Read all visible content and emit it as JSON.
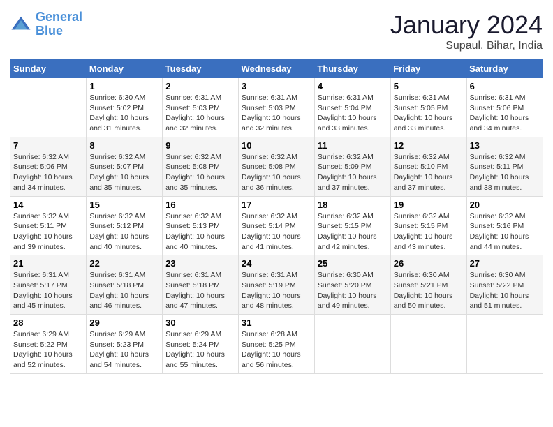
{
  "logo": {
    "line1": "General",
    "line2": "Blue"
  },
  "title": "January 2024",
  "subtitle": "Supaul, Bihar, India",
  "weekdays": [
    "Sunday",
    "Monday",
    "Tuesday",
    "Wednesday",
    "Thursday",
    "Friday",
    "Saturday"
  ],
  "weeks": [
    [
      {
        "day": "",
        "info": ""
      },
      {
        "day": "1",
        "info": "Sunrise: 6:30 AM\nSunset: 5:02 PM\nDaylight: 10 hours\nand 31 minutes."
      },
      {
        "day": "2",
        "info": "Sunrise: 6:31 AM\nSunset: 5:03 PM\nDaylight: 10 hours\nand 32 minutes."
      },
      {
        "day": "3",
        "info": "Sunrise: 6:31 AM\nSunset: 5:03 PM\nDaylight: 10 hours\nand 32 minutes."
      },
      {
        "day": "4",
        "info": "Sunrise: 6:31 AM\nSunset: 5:04 PM\nDaylight: 10 hours\nand 33 minutes."
      },
      {
        "day": "5",
        "info": "Sunrise: 6:31 AM\nSunset: 5:05 PM\nDaylight: 10 hours\nand 33 minutes."
      },
      {
        "day": "6",
        "info": "Sunrise: 6:31 AM\nSunset: 5:06 PM\nDaylight: 10 hours\nand 34 minutes."
      }
    ],
    [
      {
        "day": "7",
        "info": "Sunrise: 6:32 AM\nSunset: 5:06 PM\nDaylight: 10 hours\nand 34 minutes."
      },
      {
        "day": "8",
        "info": "Sunrise: 6:32 AM\nSunset: 5:07 PM\nDaylight: 10 hours\nand 35 minutes."
      },
      {
        "day": "9",
        "info": "Sunrise: 6:32 AM\nSunset: 5:08 PM\nDaylight: 10 hours\nand 35 minutes."
      },
      {
        "day": "10",
        "info": "Sunrise: 6:32 AM\nSunset: 5:08 PM\nDaylight: 10 hours\nand 36 minutes."
      },
      {
        "day": "11",
        "info": "Sunrise: 6:32 AM\nSunset: 5:09 PM\nDaylight: 10 hours\nand 37 minutes."
      },
      {
        "day": "12",
        "info": "Sunrise: 6:32 AM\nSunset: 5:10 PM\nDaylight: 10 hours\nand 37 minutes."
      },
      {
        "day": "13",
        "info": "Sunrise: 6:32 AM\nSunset: 5:11 PM\nDaylight: 10 hours\nand 38 minutes."
      }
    ],
    [
      {
        "day": "14",
        "info": "Sunrise: 6:32 AM\nSunset: 5:11 PM\nDaylight: 10 hours\nand 39 minutes."
      },
      {
        "day": "15",
        "info": "Sunrise: 6:32 AM\nSunset: 5:12 PM\nDaylight: 10 hours\nand 40 minutes."
      },
      {
        "day": "16",
        "info": "Sunrise: 6:32 AM\nSunset: 5:13 PM\nDaylight: 10 hours\nand 40 minutes."
      },
      {
        "day": "17",
        "info": "Sunrise: 6:32 AM\nSunset: 5:14 PM\nDaylight: 10 hours\nand 41 minutes."
      },
      {
        "day": "18",
        "info": "Sunrise: 6:32 AM\nSunset: 5:15 PM\nDaylight: 10 hours\nand 42 minutes."
      },
      {
        "day": "19",
        "info": "Sunrise: 6:32 AM\nSunset: 5:15 PM\nDaylight: 10 hours\nand 43 minutes."
      },
      {
        "day": "20",
        "info": "Sunrise: 6:32 AM\nSunset: 5:16 PM\nDaylight: 10 hours\nand 44 minutes."
      }
    ],
    [
      {
        "day": "21",
        "info": "Sunrise: 6:31 AM\nSunset: 5:17 PM\nDaylight: 10 hours\nand 45 minutes."
      },
      {
        "day": "22",
        "info": "Sunrise: 6:31 AM\nSunset: 5:18 PM\nDaylight: 10 hours\nand 46 minutes."
      },
      {
        "day": "23",
        "info": "Sunrise: 6:31 AM\nSunset: 5:18 PM\nDaylight: 10 hours\nand 47 minutes."
      },
      {
        "day": "24",
        "info": "Sunrise: 6:31 AM\nSunset: 5:19 PM\nDaylight: 10 hours\nand 48 minutes."
      },
      {
        "day": "25",
        "info": "Sunrise: 6:30 AM\nSunset: 5:20 PM\nDaylight: 10 hours\nand 49 minutes."
      },
      {
        "day": "26",
        "info": "Sunrise: 6:30 AM\nSunset: 5:21 PM\nDaylight: 10 hours\nand 50 minutes."
      },
      {
        "day": "27",
        "info": "Sunrise: 6:30 AM\nSunset: 5:22 PM\nDaylight: 10 hours\nand 51 minutes."
      }
    ],
    [
      {
        "day": "28",
        "info": "Sunrise: 6:29 AM\nSunset: 5:22 PM\nDaylight: 10 hours\nand 52 minutes."
      },
      {
        "day": "29",
        "info": "Sunrise: 6:29 AM\nSunset: 5:23 PM\nDaylight: 10 hours\nand 54 minutes."
      },
      {
        "day": "30",
        "info": "Sunrise: 6:29 AM\nSunset: 5:24 PM\nDaylight: 10 hours\nand 55 minutes."
      },
      {
        "day": "31",
        "info": "Sunrise: 6:28 AM\nSunset: 5:25 PM\nDaylight: 10 hours\nand 56 minutes."
      },
      {
        "day": "",
        "info": ""
      },
      {
        "day": "",
        "info": ""
      },
      {
        "day": "",
        "info": ""
      }
    ]
  ]
}
